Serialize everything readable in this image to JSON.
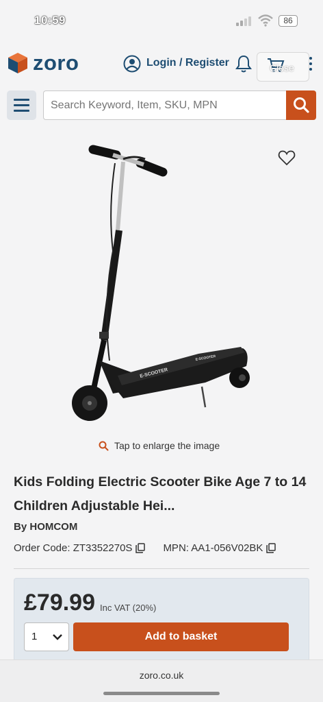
{
  "status_bar": {
    "time": "10:59",
    "battery": "86"
  },
  "header": {
    "logo_text": "zoro",
    "login_label": "Login / Register",
    "close_label": "Close"
  },
  "search": {
    "placeholder": "Search Keyword, Item, SKU, MPN"
  },
  "product": {
    "enlarge_label": "Tap to enlarge the image",
    "title": "Kids Folding Electric Scooter Bike Age 7 to 14 Children Adjustable Hei...",
    "brand_prefix": "By",
    "brand": "HOMCOM",
    "order_code": "Order Code: ZT3352270S",
    "mpn": "MPN: AA1-056V02BK",
    "deck_text": "E-SCOOTER",
    "rear_text": "E-SCOOTER"
  },
  "buy": {
    "price": "£79.99",
    "vat_label": "Inc VAT (20%)",
    "quantity": "1",
    "add_label": "Add to basket"
  },
  "browser": {
    "url": "zoro.co.uk"
  },
  "colors": {
    "brand_blue": "#1e4d72",
    "accent_orange": "#c8501c"
  }
}
